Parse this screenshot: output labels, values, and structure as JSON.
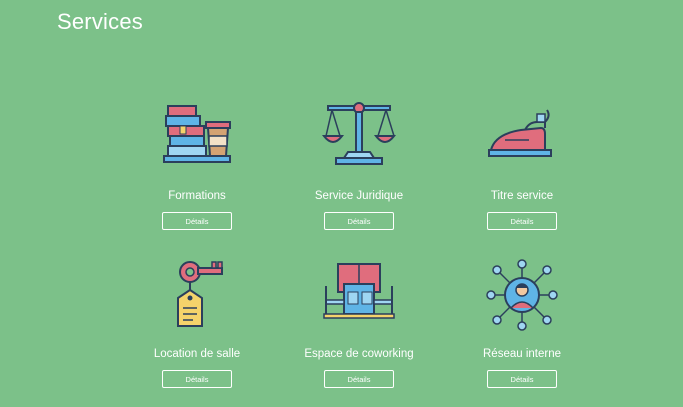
{
  "page": {
    "title": "Services"
  },
  "services": [
    {
      "label": "Formations",
      "button": "Détails",
      "icon": "books-coffee-icon"
    },
    {
      "label": "Service Juridique",
      "button": "Détails",
      "icon": "scales-icon"
    },
    {
      "label": "Titre service",
      "button": "Détails",
      "icon": "iron-icon"
    },
    {
      "label": "Location de salle",
      "button": "Détails",
      "icon": "key-tag-icon"
    },
    {
      "label": "Espace de coworking",
      "button": "Détails",
      "icon": "coworking-desk-icon"
    },
    {
      "label": "Réseau interne",
      "button": "Détails",
      "icon": "network-person-icon"
    }
  ],
  "colors": {
    "background": "#7cc189",
    "text": "#ffffff",
    "outline": "#2b3f5c",
    "blue": "#5fb4e6",
    "red": "#e06d7d",
    "yellow": "#f5d36b"
  }
}
